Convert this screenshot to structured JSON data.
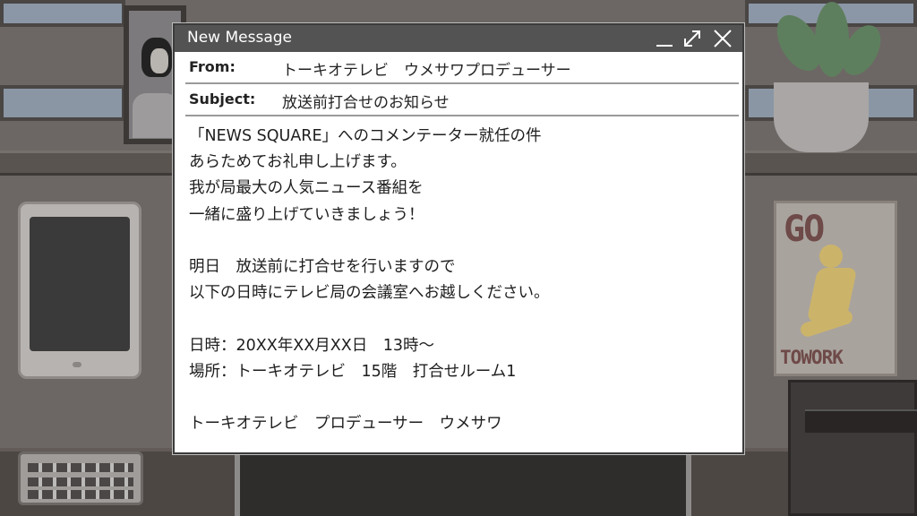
{
  "window": {
    "title": "New Message"
  },
  "header": {
    "from_label": "From:",
    "from_value": "トーキオテレビ　ウメサワプロデューサー",
    "subject_label": "Subject:",
    "subject_value": "放送前打合せのお知らせ"
  },
  "body": {
    "lines": [
      "「NEWS SQUARE」へのコメンテーター就任の件",
      "あらためてお礼申し上げます。",
      "我が局最大の人気ニュース番組を",
      "一緒に盛り上げていきましょう！",
      "",
      "明日　放送前に打合せを行いますので",
      "以下の日時にテレビ局の会議室へお越しください。",
      "",
      "日時：20XX年XX月XX日　13時～",
      "場所：トーキオテレビ　15階　打合せルーム1",
      "",
      "トーキオテレビ　プロデューサー　ウメサワ"
    ]
  },
  "poster": {
    "top_text": "GO",
    "bottom_text": "TOWORK"
  },
  "icons": {
    "minimize": "minimize-icon",
    "maximize": "maximize-icon",
    "close": "close-icon"
  },
  "colors": {
    "titlebar": "#535353",
    "window_bg": "#ffffff",
    "divider": "#9a9a9a"
  }
}
